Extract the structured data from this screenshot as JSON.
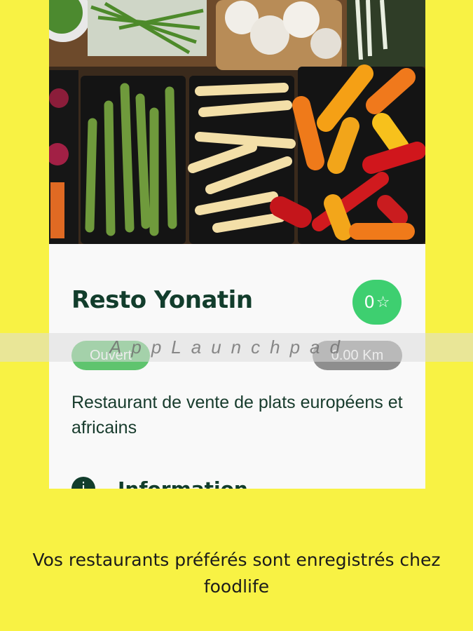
{
  "restaurant": {
    "name": "Resto Yonatin",
    "rating": "0",
    "rating_icon": "star-icon",
    "status": "Ouvert",
    "distance": "0.00 Km",
    "description": "Restaurant de vente de plats européens et africains",
    "info_section_label": "Information",
    "info_icon": "info-icon"
  },
  "watermark": "AppLaunchpad",
  "caption": "Vos restaurants préférés sont enregistrés chez foodlife",
  "colors": {
    "background": "#f8f244",
    "rating_pill": "#3ecf70",
    "status_pill": "#5fc46e",
    "distance_pill": "#8e8e8e",
    "title_text": "#123d2c"
  }
}
